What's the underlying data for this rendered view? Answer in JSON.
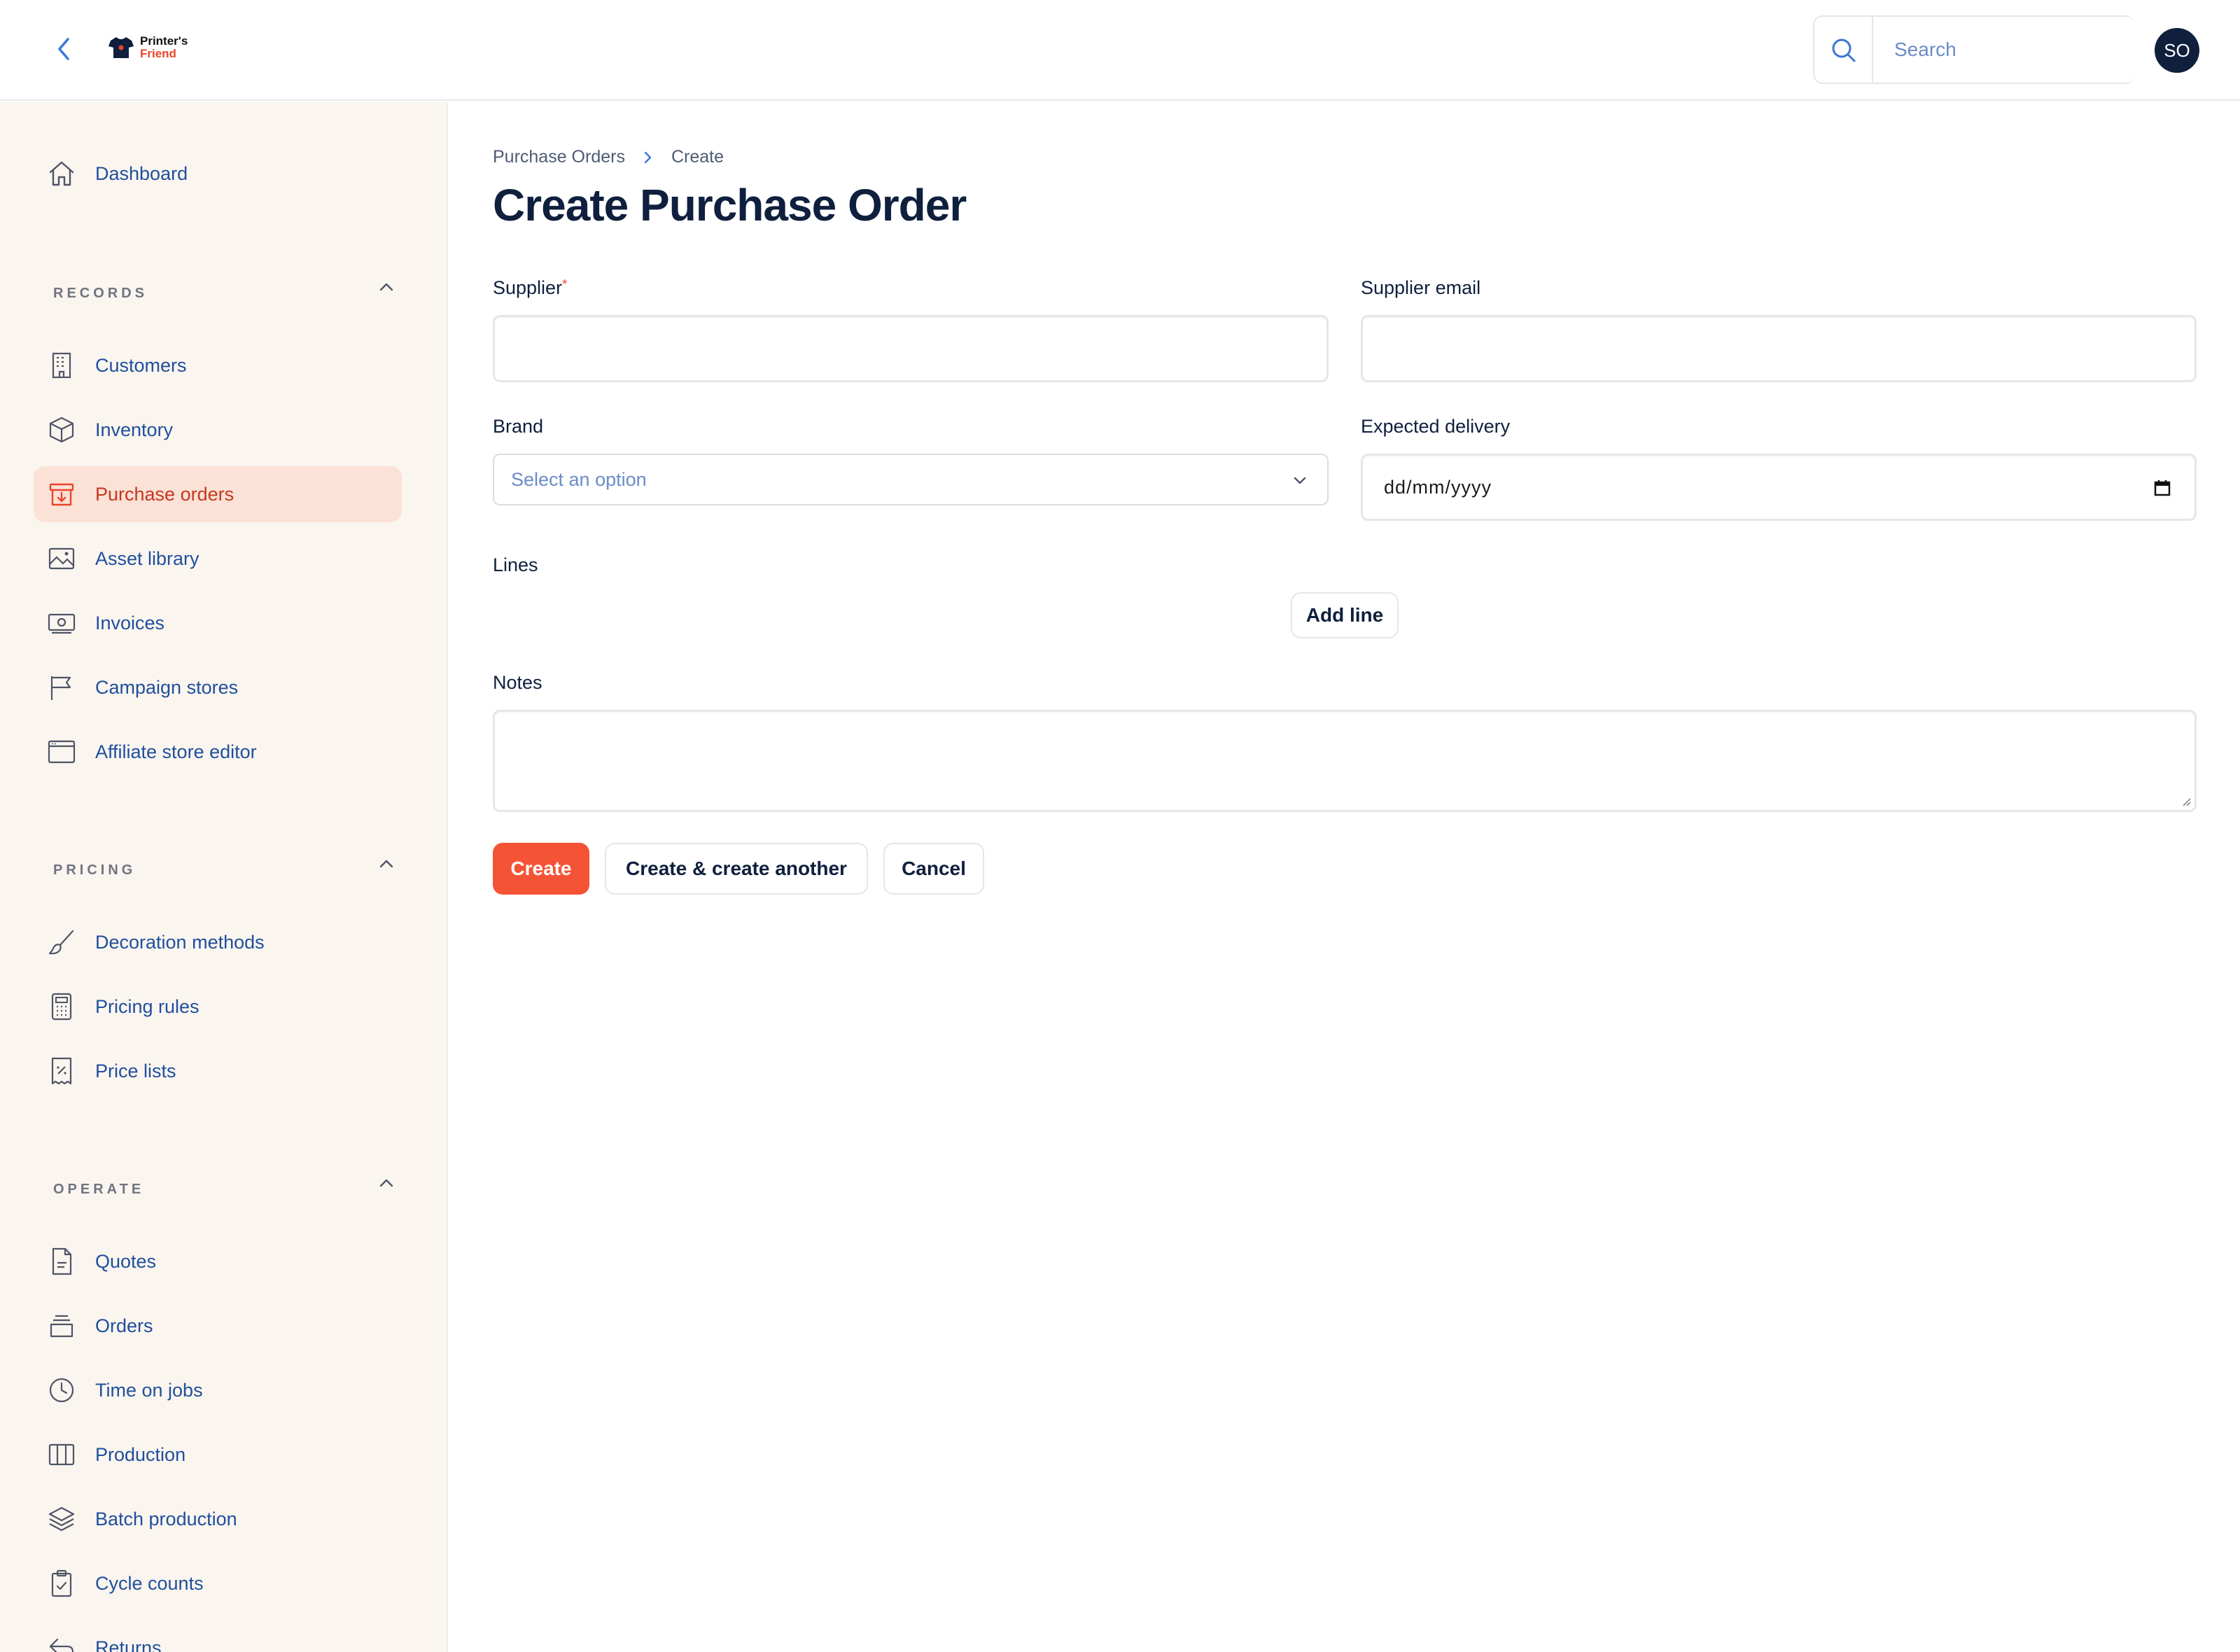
{
  "header": {
    "logo_line1": "Printer's",
    "logo_line2": "Friend",
    "search_placeholder": "Search",
    "avatar_initials": "SO"
  },
  "sidebar": {
    "dashboard": "Dashboard",
    "groups": {
      "records": "RECORDS",
      "pricing": "PRICING",
      "operate": "OPERATE"
    },
    "records_items": [
      "Customers",
      "Inventory",
      "Purchase orders",
      "Asset library",
      "Invoices",
      "Campaign stores",
      "Affiliate store editor"
    ],
    "pricing_items": [
      "Decoration methods",
      "Pricing rules",
      "Price lists"
    ],
    "operate_items": [
      "Quotes",
      "Orders",
      "Time on jobs",
      "Production",
      "Batch production",
      "Cycle counts",
      "Returns"
    ],
    "active_item": "Purchase orders"
  },
  "breadcrumb": {
    "parent": "Purchase Orders",
    "current": "Create"
  },
  "page_title": "Create Purchase Order",
  "form": {
    "supplier_label": "Supplier",
    "supplier_required_mark": "*",
    "supplier_email_label": "Supplier email",
    "brand_label": "Brand",
    "brand_placeholder": "Select an option",
    "expected_delivery_label": "Expected delivery",
    "expected_delivery_placeholder": "dd/mm/yyyy",
    "lines_label": "Lines",
    "add_line_label": "Add line",
    "notes_label": "Notes"
  },
  "actions": {
    "create": "Create",
    "create_another": "Create & create another",
    "cancel": "Cancel"
  },
  "colors": {
    "primary": "#f55336",
    "sidebar_bg": "#fbf5ef",
    "active_bg": "#fbe1d6",
    "nav_text": "#1f4f9e",
    "heading": "#0f1f3d"
  }
}
